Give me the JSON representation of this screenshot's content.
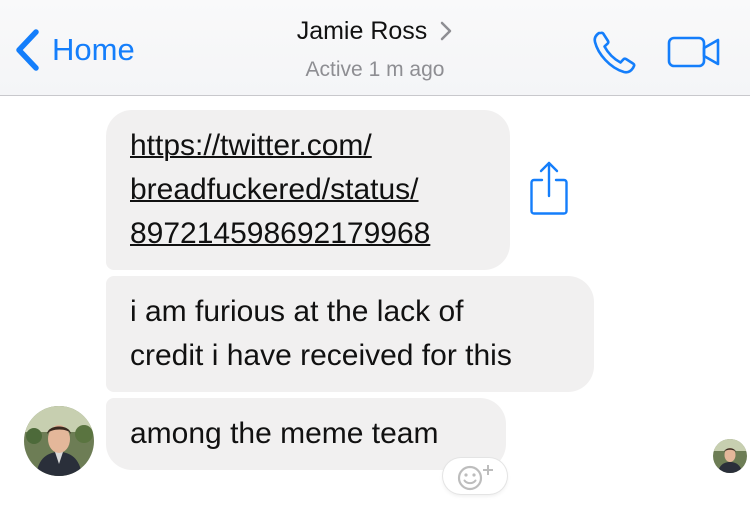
{
  "header": {
    "back_label": "Home",
    "contact_name": "Jamie Ross",
    "status": "Active 1 m ago"
  },
  "messages": [
    {
      "lines": [
        "https://twitter.com/",
        "breadfuckered/status/",
        "897214598692179968"
      ]
    },
    {
      "lines": [
        "i am furious at the lack of",
        "credit i have received for this"
      ]
    },
    {
      "lines": [
        "among the meme team"
      ]
    }
  ],
  "icons": {
    "back": "chevron-left-icon",
    "call": "phone-icon",
    "video": "video-camera-icon",
    "share": "share-icon",
    "react": "add-reaction-icon"
  },
  "colors": {
    "accent": "#147efb",
    "bubble": "#f1f0f0"
  }
}
